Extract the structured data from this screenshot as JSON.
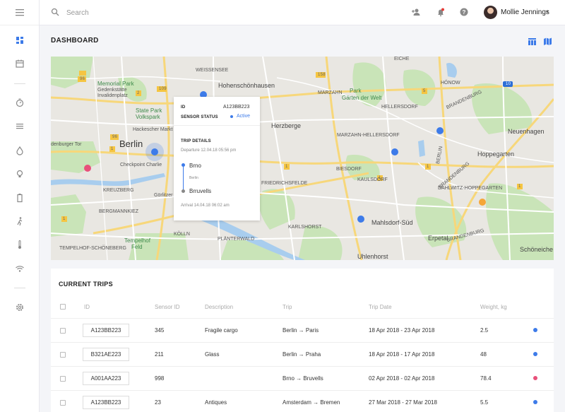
{
  "topbar": {
    "search_placeholder": "Search",
    "user_name": "Mollie Jennings",
    "user_caret": "▾"
  },
  "sidebar": {
    "items": [
      {
        "icon": "dashboard-icon"
      },
      {
        "icon": "calendar-icon"
      },
      {
        "icon": "timer-icon"
      },
      {
        "icon": "list-icon"
      },
      {
        "icon": "drop-icon"
      },
      {
        "icon": "lightbulb-icon"
      },
      {
        "icon": "battery-icon"
      },
      {
        "icon": "walking-icon"
      },
      {
        "icon": "thermometer-icon"
      },
      {
        "icon": "wifi-icon"
      },
      {
        "icon": "gear-icon"
      }
    ]
  },
  "dashboard": {
    "title": "DASHBOARD"
  },
  "map": {
    "labels": {
      "weissensee": "WEISSENSEE",
      "hohenschoenhausen": "Hohenschönhausen",
      "berlin": "Berlin",
      "memorial_park": "Memorial Park",
      "gedenkstaette": "Gedenkstätte",
      "invalidenplatz": "Invalidenplatz",
      "state_park": "State Park",
      "volkspark": "Volkspark",
      "hackescher": "Hackescher Markt",
      "checkpoint": "Checkpoint Charlie",
      "brandenburger": "denburger Tor",
      "kreuzberg": "KREUZBERG",
      "goerlitzer": "Görlitzer",
      "bergmannkiez": "BERGMANNKIEZ",
      "tempelhof_park": "Tempelhof",
      "tempelhof_feld": "Feld",
      "tempelhof_schoeneberg": "TEMPELHOF-SCHÖNEBERG",
      "mazahn": "MARZAHN",
      "park": "Park",
      "garten": "Gärten der Welt",
      "hellersdorf": "HELLERSDORF",
      "herzberge": "Herzberge",
      "marzahn_hellersdorf": "MARZAHN-HELLERSDORF",
      "neuenhagen": "Neuenhagen",
      "hoppegarten": "Hoppegarten",
      "kaulsdorf": "KAULSDORF",
      "dahlwitz": "DAHLWITZ-HOPPEGARTEN",
      "biesdorf": "BIESDORF",
      "friedrichsfelde": "FRIEDRICHSFELDE",
      "karlshorst": "KARLSHORST",
      "mahlsdorf": "Mahlsdorf-Süd",
      "erpetal": "Erpetal",
      "uhlenhorst": "Uhlenhorst",
      "plaenterwald": "PLÄNTERWALD",
      "koelln": "KÖLLN",
      "brandenburg1": "BRANDENBURG",
      "brandenburg2": "BRANDENBURG",
      "brandenburg3": "BRANDENBURG",
      "berlin_road": "BERLIN",
      "schoeneiche": "Schöneiche",
      "hoenow": "HÖNOW",
      "eiche": "EICHE",
      "road_1": "1",
      "road_109": "109",
      "road_96": "96",
      "road_158": "158",
      "road_1010": "10",
      "rd_96b": "96",
      "rd_1c": "1",
      "rd_5": "5",
      "rd_2": "2",
      "rd_1d": "1",
      "rd_1e": "1",
      "rd_1f": "1",
      "rd_1g": "1",
      "rd_1h": "1",
      "rd_96c": "96",
      "rd_96d": "96",
      "rd_1i": "1",
      "rd_1j": "1",
      "rd_96e": "96",
      "rd_96f": "96",
      "rd_1k": "1",
      "rd_1l": "1"
    },
    "tooltip": {
      "id_label": "ID",
      "id_value": "A123BB223",
      "status_label": "SENSOR STATUS",
      "status_value": "Active",
      "trip_details_label": "TRIP DETAILS",
      "departure": "Departure 12.04.18 05:56 pm",
      "origin": "Brno",
      "midpoint": "Berlin",
      "destination": "Brruvells",
      "arrival": "Arrival 14.04.18 06:02 am"
    },
    "colors": {
      "pin_blue": "#3d7be9",
      "pin_red": "#e8507a",
      "pin_orange": "#f5a638",
      "status_active": "#3d7be9"
    }
  },
  "trips": {
    "title": "CURRENT TRIPS",
    "headers": [
      "ID",
      "Sensor ID",
      "Description",
      "Trip",
      "Trip Date",
      "Weight, kg"
    ],
    "rows": [
      {
        "id": "A123BB223",
        "sensor": "345",
        "description": "Fragile cargo",
        "trip": "Berlin → Paris",
        "date": "18 Apr 2018 - 23 Apr 2018",
        "weight": "2.5",
        "status_color": "#3d7be9"
      },
      {
        "id": "B321AE223",
        "sensor": "211",
        "description": "Glass",
        "trip": "Berlin → Praha",
        "date": "18 Apr 2018 - 17 Apr 2018",
        "weight": "48",
        "status_color": "#3d7be9"
      },
      {
        "id": "A001AA223",
        "sensor": "998",
        "description": "",
        "trip": "Brno → Bruvells",
        "date": "02 Apr 2018 - 02 Apr 2018",
        "weight": "78.4",
        "status_color": "#e8507a"
      },
      {
        "id": "A123BB223",
        "sensor": "23",
        "description": "Antiques",
        "trip": "Amsterdam → Bremen",
        "date": "27 Mar 2018 - 27 Mar 2018",
        "weight": "5.5",
        "status_color": "#3d7be9"
      }
    ]
  }
}
